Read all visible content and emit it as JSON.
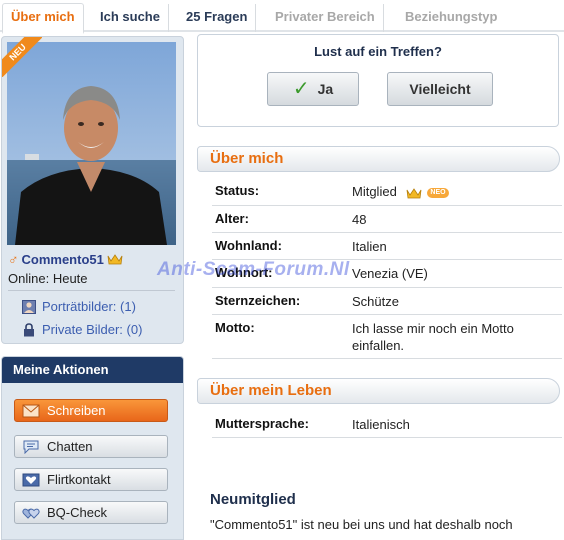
{
  "tabs": [
    {
      "label": "Über mich"
    },
    {
      "label": "Ich suche"
    },
    {
      "label": "25 Fragen"
    },
    {
      "label": "Privater Bereich"
    },
    {
      "label": "Beziehungstyp"
    }
  ],
  "profile": {
    "badge_new": "NEU",
    "username": "Commento51",
    "online_label": "Online:",
    "online_value": "Heute",
    "portrait_link": "Porträtbilder: (1)",
    "private_link": "Private Bilder: (0)"
  },
  "actions": {
    "title": "Meine Aktionen",
    "buttons": [
      {
        "label": "Schreiben",
        "icon": "envelope-icon"
      },
      {
        "label": "Chatten",
        "icon": "chat-bubble-icon"
      },
      {
        "label": "Flirtkontakt",
        "icon": "flirt-card-icon"
      },
      {
        "label": "BQ-Check",
        "icon": "hearts-icon"
      }
    ]
  },
  "meeting": {
    "question": "Lust auf ein Treffen?",
    "yes_label": "Ja",
    "maybe_label": "Vielleicht"
  },
  "about": {
    "title": "Über mich",
    "rows": [
      {
        "label": "Status:",
        "value": "Mitglied"
      },
      {
        "label": "Alter:",
        "value": "48"
      },
      {
        "label": "Wohnland:",
        "value": "Italien"
      },
      {
        "label": "Wohnort:",
        "value": "Venezia (VE)"
      },
      {
        "label": "Sternzeichen:",
        "value": "Schütze"
      },
      {
        "label": "Motto:",
        "value": "Ich lasse mir noch ein Motto einfallen."
      }
    ],
    "status_badge": "NEO"
  },
  "life": {
    "title": "Über mein Leben",
    "rows": [
      {
        "label": "Muttersprache:",
        "value": "Italienisch"
      }
    ]
  },
  "new_member": {
    "title": "Neumitglied",
    "text": "\"Commento51\" ist neu bei uns und hat deshalb noch"
  },
  "watermark": "Anti-Scam-Forum.Nl",
  "colors": {
    "accent_orange": "#e86e10",
    "nav_dark_blue": "#1f3a66",
    "link_blue": "#3c5eb0",
    "card_background": "#dfe7ef"
  }
}
